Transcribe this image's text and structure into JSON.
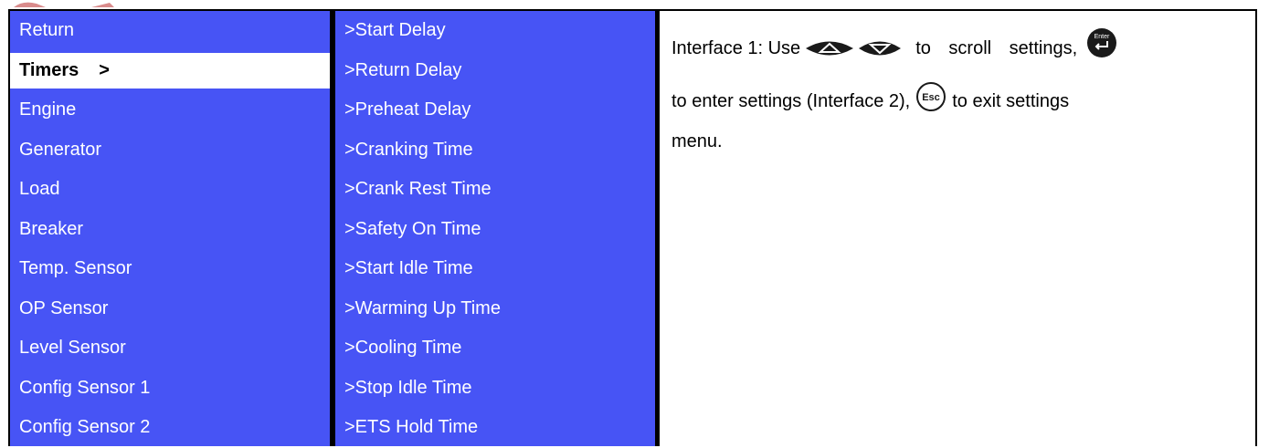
{
  "left_menu": {
    "items": [
      {
        "label": "Return"
      },
      {
        "label": "Timers",
        "suffix": ">"
      },
      {
        "label": "Engine"
      },
      {
        "label": "Generator"
      },
      {
        "label": "Load"
      },
      {
        "label": "Breaker"
      },
      {
        "label": "Temp. Sensor"
      },
      {
        "label": "OP Sensor"
      },
      {
        "label": "Level Sensor"
      },
      {
        "label": "Config Sensor 1"
      },
      {
        "label": "Config Sensor 2"
      }
    ],
    "selected_index": 1
  },
  "sub_menu": {
    "items": [
      {
        "label": ">Start Delay"
      },
      {
        "label": ">Return Delay"
      },
      {
        "label": ">Preheat Delay"
      },
      {
        "label": ">Cranking Time"
      },
      {
        "label": ">Crank Rest Time"
      },
      {
        "label": ">Safety On Time"
      },
      {
        "label": ">Start Idle Time"
      },
      {
        "label": ">Warming Up Time"
      },
      {
        "label": ">Cooling Time"
      },
      {
        "label": ">Stop Idle Time"
      },
      {
        "label": ">ETS Hold Time"
      }
    ]
  },
  "description": {
    "line1_a": "Interface 1: Use",
    "line1_b": "to scroll settings,",
    "line2_a": "to enter settings (Interface 2),",
    "line2_b": "to exit settings",
    "line3": "menu.",
    "enter_key_label": "Enter",
    "esc_key_label": "Esc"
  },
  "icons": {
    "up": "up-arrow-key-icon",
    "down": "down-arrow-key-icon",
    "enter": "enter-key-icon",
    "esc": "esc-key-icon"
  },
  "colors": {
    "menu_bg": "#4754f5",
    "selected_bg": "#ffffff",
    "text_light": "#ffffff"
  }
}
